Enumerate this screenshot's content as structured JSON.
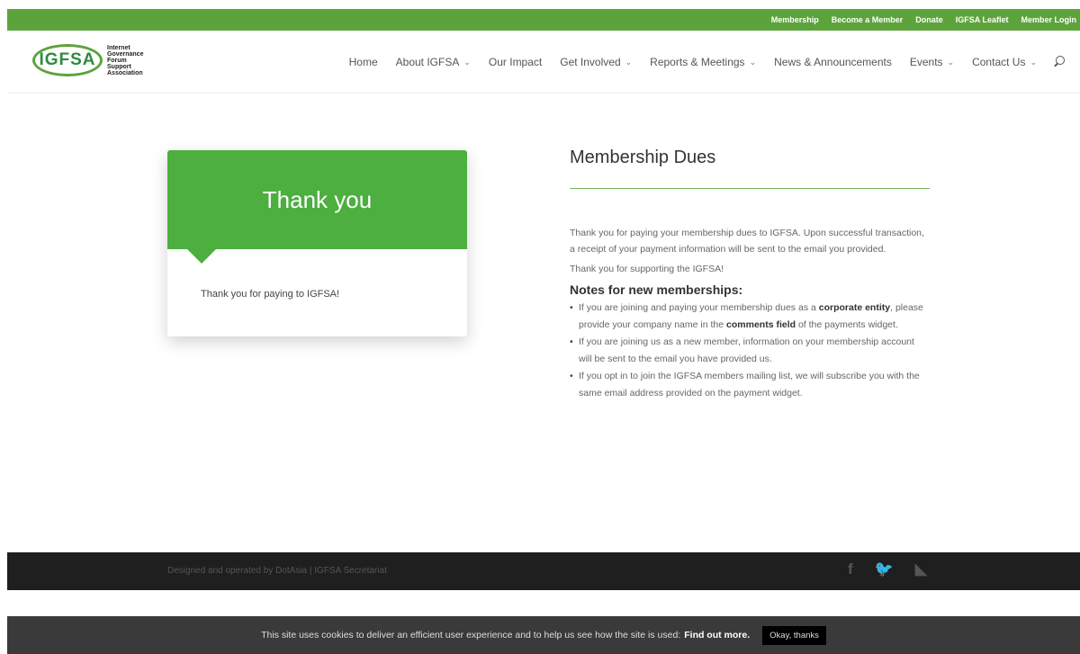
{
  "topbar": {
    "links": [
      "Membership",
      "Become a Member",
      "Donate",
      "IGFSA Leaflet",
      "Member Login"
    ]
  },
  "logo": {
    "mark": "IGFSA",
    "text": "Internet Governance Forum Support Association"
  },
  "nav": {
    "home": "Home",
    "about": "About IGFSA",
    "impact": "Our Impact",
    "involved": "Get Involved",
    "reports": "Reports & Meetings",
    "news": "News & Announcements",
    "events": "Events",
    "contact": "Contact Us",
    "chevron": "⌄"
  },
  "card": {
    "title": "Thank you",
    "message": "Thank you for paying to IGFSA!"
  },
  "content": {
    "title": "Membership Dues",
    "p1": "Thank you for paying your membership dues to IGFSA.  Upon successful transaction, a receipt of your payment information will be sent to the email you provided.",
    "p2": "Thank you for supporting the IGFSA!",
    "notes_title": "Notes for new memberships:",
    "note1_a": "If you are joining and paying your membership dues as a ",
    "note1_b": "corporate entity",
    "note1_c": ", please provide your company name in the ",
    "note1_d": "comments field",
    "note1_e": " of the payments widget.",
    "note2": "If you are joining us as a new member, information on your membership account will be sent to the email you have provided us.",
    "note3": "If you opt in to join the IGFSA members mailing list, we will subscribe you with the same email address provided on the payment widget."
  },
  "footer": {
    "text": "Designed and operated by DotAsia | IGFSA Secretariat",
    "icons": [
      "facebook-icon",
      "twitter-icon",
      "rss-icon"
    ]
  },
  "cookie": {
    "text": "This site uses cookies to deliver an efficient user experience and to help us see how the site is used:",
    "link": "Find out more.",
    "button": "Okay, thanks"
  },
  "colors": {
    "brand_green": "#5da33c",
    "card_green": "#4caf3f",
    "footer_bg": "#1f1f1f",
    "cookie_bg": "#3a3a3a"
  }
}
